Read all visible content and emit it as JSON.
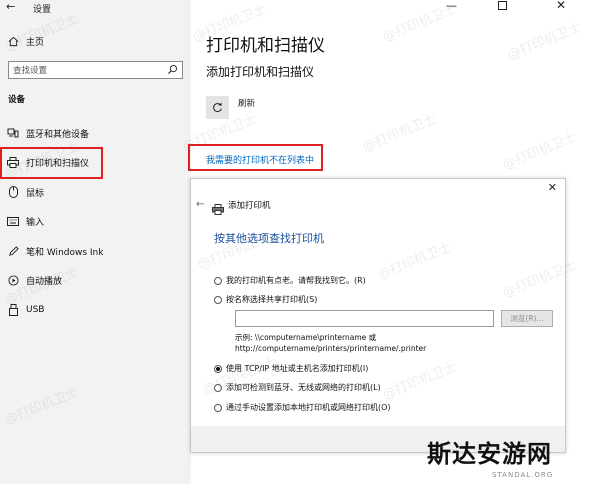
{
  "window": {
    "title": "设置",
    "minimize_icon": "minimize-icon",
    "maximize_icon": "maximize-icon",
    "close_icon": "close-icon"
  },
  "sidebar": {
    "home_label": "主页",
    "search_placeholder": "查找设置",
    "section_label": "设备",
    "items": [
      {
        "label": "蓝牙和其他设备",
        "icon": "bluetooth-icon"
      },
      {
        "label": "打印机和扫描仪",
        "icon": "printer-icon",
        "selected": true
      },
      {
        "label": "鼠标",
        "icon": "mouse-icon"
      },
      {
        "label": "输入",
        "icon": "keyboard-icon"
      },
      {
        "label": "笔和 Windows Ink",
        "icon": "pen-icon"
      },
      {
        "label": "自动播放",
        "icon": "autoplay-icon"
      },
      {
        "label": "USB",
        "icon": "usb-icon"
      }
    ]
  },
  "main": {
    "title": "打印机和扫描仪",
    "subtitle": "添加打印机和扫描仪",
    "refresh_label": "刷新",
    "missing_link": "我需要的打印机不在列表中"
  },
  "dialog": {
    "title": "添加打印机",
    "heading": "按其他选项查找打印机",
    "options": [
      {
        "label": "我的打印机有点老。请帮我找到它。(R)",
        "checked": false
      },
      {
        "label": "按名称选择共享打印机(S)",
        "checked": false
      },
      {
        "label": "使用 TCP/IP 地址或主机名添加打印机(I)",
        "checked": true
      },
      {
        "label": "添加可检测到蓝牙、无线或网络的打印机(L)",
        "checked": false
      },
      {
        "label": "通过手动设置添加本地打印机或网络打印机(O)",
        "checked": false
      }
    ],
    "share_input_value": "",
    "browse_label": "浏览(R)...",
    "example_line1": "示例: \\\\computername\\printername 或",
    "example_line2": "http://computername/printers/printername/.printer"
  },
  "watermark": {
    "text": "@打印机卫士",
    "brand_logo": "斯达安游网",
    "brand_url": "STANDAL.ORG"
  },
  "colors": {
    "highlight": "#e02020",
    "link": "#0067c0",
    "dialog_heading": "#1a4f9c"
  }
}
